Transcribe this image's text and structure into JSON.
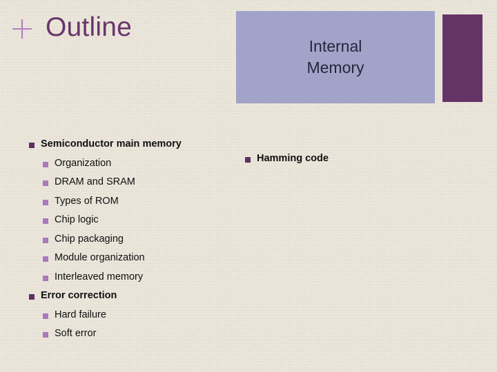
{
  "slide": {
    "title": "Outline",
    "plus_icon": "plus-icon",
    "background_color": "#e9e3d6"
  },
  "banner": {
    "text": "Internal\nMemory",
    "box_color": "#a1a3c9",
    "text_color": "#26263c",
    "accent_color": "#653466"
  },
  "outline": {
    "items": [
      {
        "level": 1,
        "label": "Semiconductor main memory"
      },
      {
        "level": 2,
        "label": "Organization"
      },
      {
        "level": 2,
        "label": "DRAM and SRAM"
      },
      {
        "level": 2,
        "label": "Types of ROM"
      },
      {
        "level": 2,
        "label": "Chip logic"
      },
      {
        "level": 2,
        "label": "Chip packaging"
      },
      {
        "level": 2,
        "label": "Module organization"
      },
      {
        "level": 2,
        "label": "Interleaved memory"
      },
      {
        "level": 1,
        "label": "Error correction"
      },
      {
        "level": 2,
        "label": "Hard failure"
      },
      {
        "level": 2,
        "label": "Soft error"
      }
    ]
  },
  "right_column": {
    "items": [
      {
        "level": 1,
        "label": "Hamming code"
      }
    ]
  },
  "colors": {
    "title": "#69356c",
    "bullet_level_1": "#5d2f63",
    "bullet_level_2": "#aa78bc",
    "plus": "#b07fc4",
    "body_text": "#101010"
  }
}
